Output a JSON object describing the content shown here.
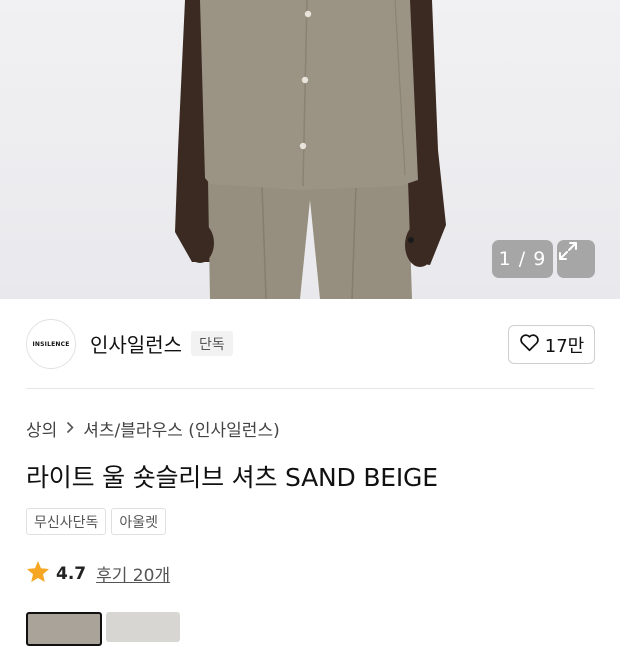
{
  "gallery": {
    "counter": "1 / 9",
    "expand_icon": "expand-icon"
  },
  "brand": {
    "logo_text": "INSILENCE",
    "name": "인사일런스",
    "badge": "단독",
    "like_count": "17만",
    "like_icon": "heart-icon"
  },
  "breadcrumb": {
    "category": "상의",
    "subcategory": "셔츠/블라우스 (인사일런스)"
  },
  "product": {
    "title": "라이트 울 숏슬리브 셔츠 SAND BEIGE",
    "tags": [
      "무신사단독",
      "아울렛"
    ]
  },
  "rating": {
    "score": "4.7",
    "review_link": "후기 20개",
    "star_color": "#f5a623"
  },
  "colors": {
    "fabric": "#9b9383",
    "skin": "#3a2a22",
    "accent": "#111111"
  }
}
